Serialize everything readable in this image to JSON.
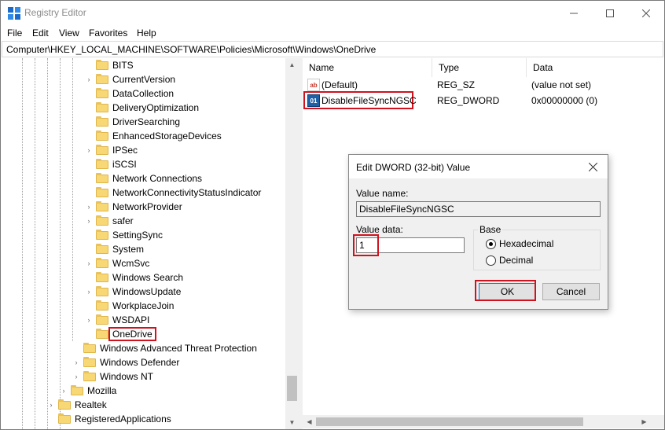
{
  "window": {
    "title": "Registry Editor"
  },
  "menu": {
    "file": "File",
    "edit": "Edit",
    "view": "View",
    "favorites": "Favorites",
    "help": "Help"
  },
  "address": "Computer\\HKEY_LOCAL_MACHINE\\SOFTWARE\\Policies\\Microsoft\\Windows\\OneDrive",
  "tree": {
    "windows_children": [
      {
        "label": "BITS",
        "expandable": false
      },
      {
        "label": "CurrentVersion",
        "expandable": true
      },
      {
        "label": "DataCollection",
        "expandable": false
      },
      {
        "label": "DeliveryOptimization",
        "expandable": false
      },
      {
        "label": "DriverSearching",
        "expandable": false
      },
      {
        "label": "EnhancedStorageDevices",
        "expandable": false
      },
      {
        "label": "IPSec",
        "expandable": true
      },
      {
        "label": "iSCSI",
        "expandable": false
      },
      {
        "label": "Network Connections",
        "expandable": false
      },
      {
        "label": "NetworkConnectivityStatusIndicator",
        "expandable": false
      },
      {
        "label": "NetworkProvider",
        "expandable": true
      },
      {
        "label": "safer",
        "expandable": true
      },
      {
        "label": "SettingSync",
        "expandable": false
      },
      {
        "label": "System",
        "expandable": false
      },
      {
        "label": "WcmSvc",
        "expandable": true
      },
      {
        "label": "Windows Search",
        "expandable": false
      },
      {
        "label": "WindowsUpdate",
        "expandable": true
      },
      {
        "label": "WorkplaceJoin",
        "expandable": false
      },
      {
        "label": "WSDAPI",
        "expandable": true
      },
      {
        "label": "OneDrive",
        "expandable": false,
        "selected": true
      }
    ],
    "microsoft_children": [
      {
        "label": "Windows Advanced Threat Protection",
        "expandable": false
      },
      {
        "label": "Windows Defender",
        "expandable": true
      },
      {
        "label": "Windows NT",
        "expandable": true
      }
    ],
    "policies_children": [
      {
        "label": "Mozilla",
        "expandable": true
      }
    ],
    "software_children": [
      {
        "label": "Realtek",
        "expandable": true
      },
      {
        "label": "RegisteredApplications",
        "expandable": false
      }
    ]
  },
  "list": {
    "columns": {
      "name": "Name",
      "type": "Type",
      "data": "Data"
    },
    "rows": [
      {
        "name": "(Default)",
        "type": "REG_SZ",
        "data": "(value not set)",
        "icon": "reg-sz-icon"
      },
      {
        "name": "DisableFileSyncNGSC",
        "type": "REG_DWORD",
        "data": "0x00000000 (0)",
        "icon": "reg-dword-icon"
      }
    ]
  },
  "dialog": {
    "title": "Edit DWORD (32-bit) Value",
    "value_name_label": "Value name:",
    "value_name": "DisableFileSyncNGSC",
    "value_data_label": "Value data:",
    "value_data": "1",
    "base_label": "Base",
    "hex_label": "Hexadecimal",
    "dec_label": "Decimal",
    "base_selected": "Hexadecimal",
    "ok": "OK",
    "cancel": "Cancel"
  },
  "colors": {
    "highlight": "#d0121e",
    "folder": "#f8d775",
    "dialog_bg": "#f0f0f0"
  }
}
